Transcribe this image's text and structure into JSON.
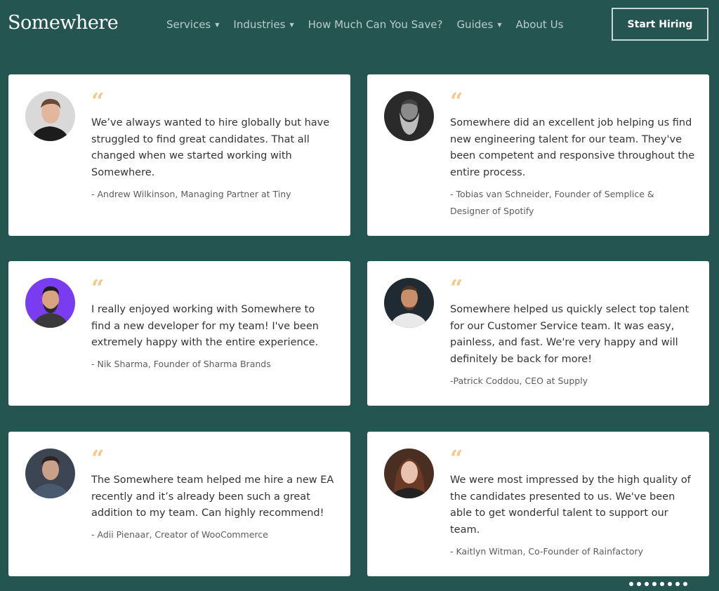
{
  "header": {
    "logo": "Somewhere",
    "nav": [
      {
        "label": "Services",
        "has_dropdown": true
      },
      {
        "label": "Industries",
        "has_dropdown": true
      },
      {
        "label": "How Much Can You Save?",
        "has_dropdown": false
      },
      {
        "label": "Guides",
        "has_dropdown": true
      },
      {
        "label": "About Us",
        "has_dropdown": false
      }
    ],
    "cta_label": "Start Hiring"
  },
  "colors": {
    "background": "#245550",
    "card": "#ffffff",
    "quote_accent": "#f2c98c"
  },
  "testimonials": [
    {
      "quote_mark": "“",
      "text": "We’ve always wanted to hire globally but have struggled to find great candidates. That all changed when we started working with Somewhere.",
      "attribution": "- Andrew Wilkinson, Managing Partner at Tiny"
    },
    {
      "quote_mark": "“",
      "text": "Somewhere did an excellent job helping us find new engineering talent for our team. They've been competent and responsive throughout the entire process.",
      "attribution": "- Tobias van Schneider, Founder of Semplice & Designer of Spotify"
    },
    {
      "quote_mark": "“",
      "text": "I really enjoyed working with Somewhere to find a new developer for my team! I've been extremely happy with the entire experience.",
      "attribution": "- Nik Sharma, Founder of Sharma Brands"
    },
    {
      "quote_mark": "“",
      "text": "Somewhere helped us quickly select top talent for our Customer Service team. It was easy, painless, and fast. We're very happy and will definitely be back for more!",
      "attribution": "-Patrick Coddou, CEO at Supply"
    },
    {
      "quote_mark": "“",
      "text": "The Somewhere team helped me hire a new EA recently and it’s already been such a great addition to my team. Can highly recommend!",
      "attribution": "- Adii Pienaar, Creator of WooCommerce"
    },
    {
      "quote_mark": "“",
      "text": "We were most impressed by the high quality of the candidates presented to us. We've been able to get wonderful talent to support our team.",
      "attribution": "- Kaitlyn Witman, Co-Founder of Rainfactory"
    }
  ],
  "pagination": {
    "count": 8
  }
}
